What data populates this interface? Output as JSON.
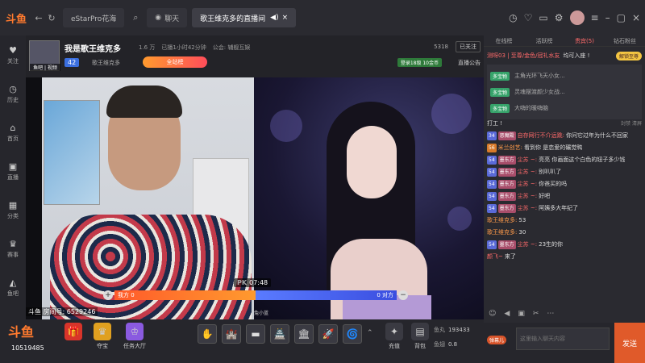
{
  "topbar": {
    "logo": "斗鱼",
    "tabs": [
      {
        "label": "eStarPro花海"
      },
      {
        "label": "聊天"
      },
      {
        "label": "歌王维克多的直播间"
      }
    ]
  },
  "sidebar": {
    "items": [
      {
        "label": "关注",
        "icon": "heart-icon"
      },
      {
        "label": "历史",
        "icon": "clock-icon"
      },
      {
        "label": "首页",
        "icon": "home-icon"
      },
      {
        "label": "直播",
        "icon": "tv-icon"
      },
      {
        "label": "分类",
        "icon": "grid-icon"
      },
      {
        "label": "赛事",
        "icon": "trophy-icon"
      },
      {
        "label": "鱼吧",
        "icon": "fish-icon"
      }
    ]
  },
  "streamer": {
    "title": "我是歌王维克多",
    "avatar_tag": "鱼吧 | 视频",
    "fans": "1.6 万",
    "duration": "已播1小时42分钟",
    "guild": "公会: 辅舰互娱",
    "level": "42",
    "name": "歌王维克多",
    "follow_label": "全站榜",
    "heat": "5318",
    "followed_label": "已关注",
    "login_gift": "登录18级 10金币",
    "notice_label": "直播公告"
  },
  "pk": {
    "label": "PK",
    "time": "07:48",
    "left_label": "我方 0",
    "right_label": "0 对方"
  },
  "video": {
    "room_id_line": "斗鱼 房间号: 6529246",
    "mini_name": "兔小蓝"
  },
  "bottom": {
    "logo": "斗鱼",
    "fans_id": "10519485",
    "buttons": [
      {
        "label": "",
        "icon": "gift-box-icon",
        "color": "#d8342a"
      },
      {
        "label": "夺宝",
        "icon": "trophy-gift-icon",
        "color": "#e0a020"
      },
      {
        "label": "任务大厅",
        "icon": "crown-icon",
        "color": "#8a5ae0"
      }
    ],
    "gift_slots": [
      "✋",
      "🏰",
      "▬",
      "🏯",
      "🏛",
      "🚀",
      "🌀"
    ],
    "recharge_label": "充值",
    "bag_label": "背包",
    "fish_pill_label": "鱼丸",
    "fish_pill_value": "193433",
    "fish_ball_label": "鱼翅",
    "fish_ball_value": "0.8"
  },
  "chat": {
    "tabs": [
      "在线榜",
      "活跃榜",
      "贵宾(5)",
      "钻石粉丝"
    ],
    "welcome_name": "测呀03 | 至尊/金色/冠礼水友",
    "welcome_text": "均可入座 !",
    "unlock_label": "解锁至尊",
    "pinned": [
      {
        "badge": "多宝物",
        "text": "主角光环飞天小女..."
      },
      {
        "badge": "多宝物",
        "text": "灵魂摆渡颜少女战..."
      },
      {
        "badge": "多宝物",
        "text": "大嗨的暖嗨脑"
      }
    ],
    "messages": [
      {
        "lv": "",
        "fan": "",
        "user": "",
        "text": "打工 !",
        "tools": "封禁  清屏"
      },
      {
        "lv": "34",
        "fan": "恶魔殿",
        "user": "自存网行不介远跳:",
        "text": "你问它过年为什么不回家"
      },
      {
        "lv": "56",
        "fan": "",
        "user": "米兰创艺:",
        "text": "看到你 是恋爱的碾觉鸭"
      },
      {
        "lv": "54",
        "fan": "墨东方",
        "user": "尘苏 ~:",
        "text": "亮亮 你画面这个白色的钮子多少钱"
      },
      {
        "lv": "54",
        "fan": "墨东方",
        "user": "尘苏 ~:",
        "text": "别叭叭了"
      },
      {
        "lv": "54",
        "fan": "墨东方",
        "user": "尘苏 ~:",
        "text": "你爸买的吗"
      },
      {
        "lv": "54",
        "fan": "墨东方",
        "user": "尘苏 ~:",
        "text": "好吧"
      },
      {
        "lv": "54",
        "fan": "墨东方",
        "user": "尘苏 ~:",
        "text": "阿姨多大年纪了"
      },
      {
        "lv": "",
        "fan": "",
        "user": "歌王维克多:",
        "text": "53"
      },
      {
        "lv": "",
        "fan": "",
        "user": "歌王维克多:",
        "text": "30"
      },
      {
        "lv": "54",
        "fan": "墨东方",
        "user": "尘苏 ~:",
        "text": "23生的你"
      },
      {
        "lv": "",
        "fan": "",
        "user": "颜飞~",
        "text": "来了"
      }
    ],
    "input_placeholder": "这里输入聊天内容",
    "barrage_label": "弹幕儿",
    "send_label": "发送"
  }
}
